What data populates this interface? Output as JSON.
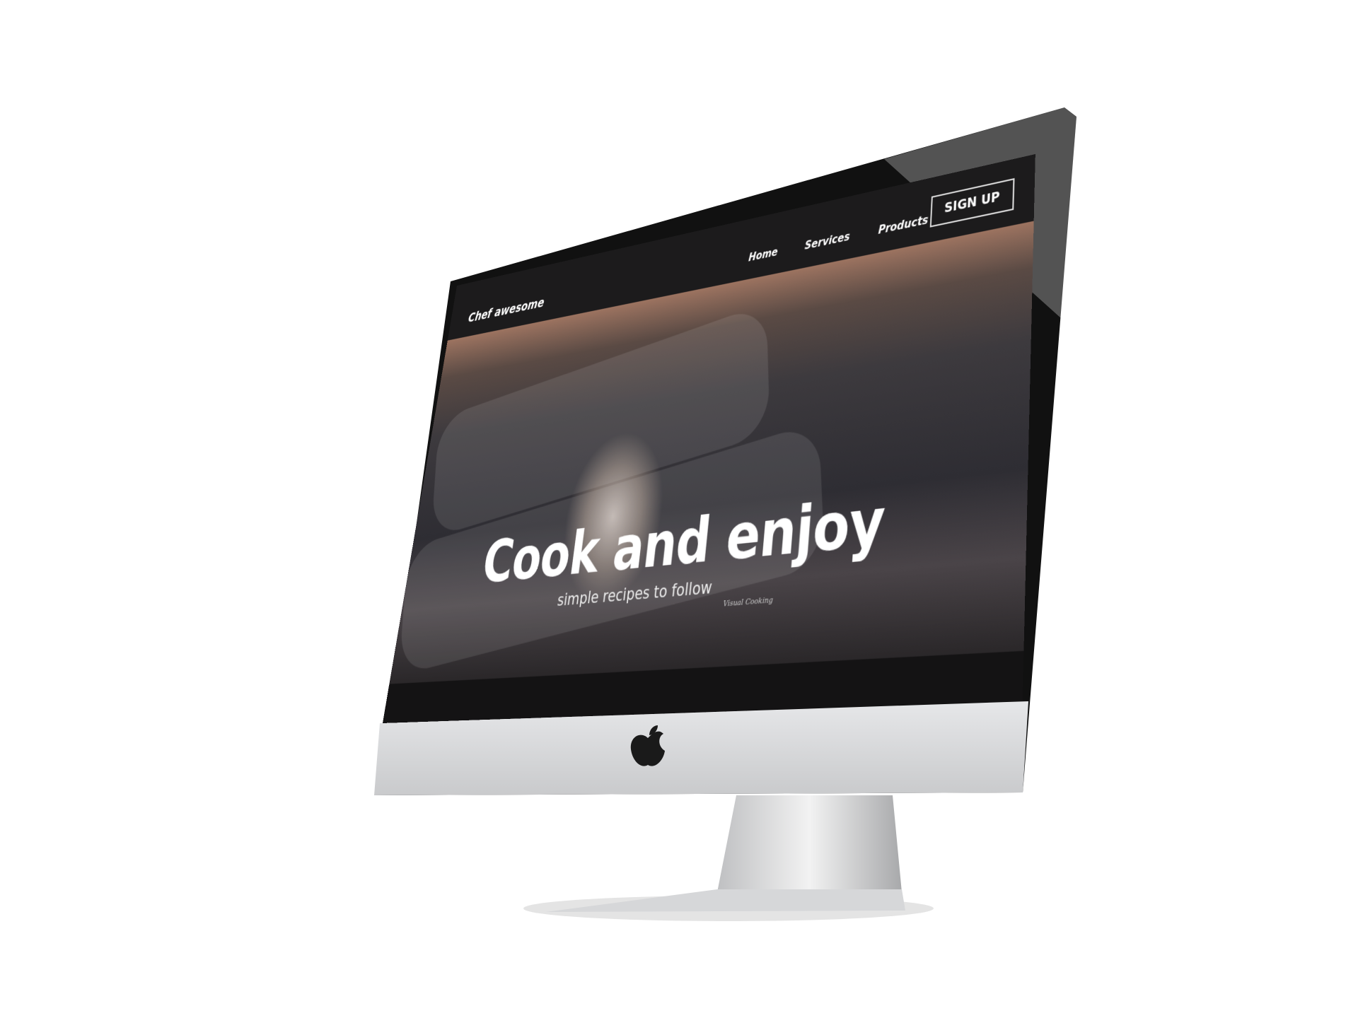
{
  "site": {
    "logo": "Chef awesome",
    "nav": [
      {
        "label": "Home"
      },
      {
        "label": "Services"
      },
      {
        "label": "Products"
      }
    ],
    "signup_label": "SIGN UP"
  },
  "hero": {
    "title": "Cook and enjoy",
    "subtitle": "simple recipes to follow",
    "signage": "Visual Cooking"
  },
  "device": {
    "logo_icon": "apple-logo-icon"
  },
  "colors": {
    "header": "#1c1b1c",
    "bezel": "#111111",
    "chin": "#d9dadc"
  }
}
